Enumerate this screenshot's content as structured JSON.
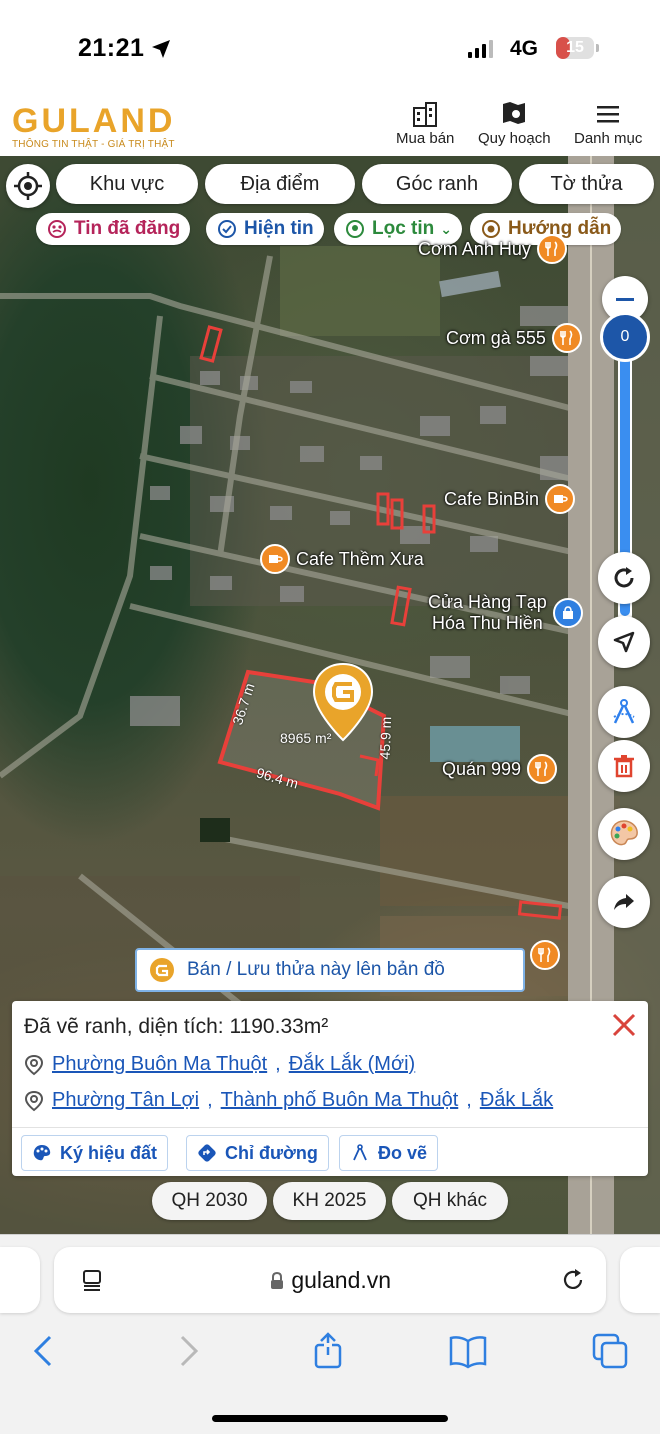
{
  "status_bar": {
    "time": "21:21",
    "network": "4G",
    "battery": "15",
    "battery_level": 0.15
  },
  "header": {
    "logo_text": "GULAND",
    "tagline": "THÔNG TIN THẬT - GIÁ TRỊ THẬT",
    "nav": [
      {
        "label": "Mua bán",
        "icon": "building-icon"
      },
      {
        "label": "Quy hoạch",
        "icon": "map-search-icon"
      },
      {
        "label": "Danh mục",
        "icon": "menu-icon"
      }
    ]
  },
  "filters": {
    "items": [
      "Khu vực",
      "Địa điểm",
      "Góc ranh",
      "Tờ thửa"
    ]
  },
  "chips": {
    "posted": "Tin đã đăng",
    "show": "Hiện tin",
    "filter": "Lọc tin",
    "guide": "Hướng dẫn"
  },
  "map": {
    "zoom_value": "0",
    "parcel_area": "8965 m²",
    "edges": {
      "left": "36.7 m",
      "right": "45.9 m",
      "bottom": "96.4 m"
    },
    "pois": [
      {
        "name": "Cơm Anh Huy",
        "kind": "restaurant"
      },
      {
        "name": "Cơm gà 555",
        "kind": "restaurant"
      },
      {
        "name": "Cafe BinBin",
        "kind": "cafe"
      },
      {
        "name": "Cafe Thềm Xưa",
        "kind": "cafe"
      },
      {
        "name": "Cửa Hàng Tạp Hóa Thu Hiền",
        "line1": "Cửa Hàng Tạp",
        "line2": "Hóa Thu Hiền",
        "kind": "shop"
      },
      {
        "name": "Quán 999",
        "kind": "restaurant"
      }
    ],
    "sell_banner": "Bán / Lưu thửa này lên bản đồ"
  },
  "info_card": {
    "title": "Đã vẽ ranh, diện tích: 1190.33m²",
    "address_new": [
      "Phường Buôn Ma Thuột",
      "Đắk Lắk (Mới)"
    ],
    "address_old": [
      "Phường Tân Lợi",
      "Thành phố Buôn Ma Thuột",
      "Đắk Lắk"
    ],
    "buttons": [
      "Ký hiệu đất",
      "Chỉ đường",
      "Đo vẽ"
    ]
  },
  "plan_tabs": [
    "QH 2030",
    "KH 2025",
    "QH khác"
  ],
  "browser": {
    "url": "guland.vn"
  },
  "colors": {
    "brand": "#e9a42a",
    "link": "#1a56b8",
    "plot_red": "#e8403a",
    "accent_blue": "#2f80ed"
  }
}
